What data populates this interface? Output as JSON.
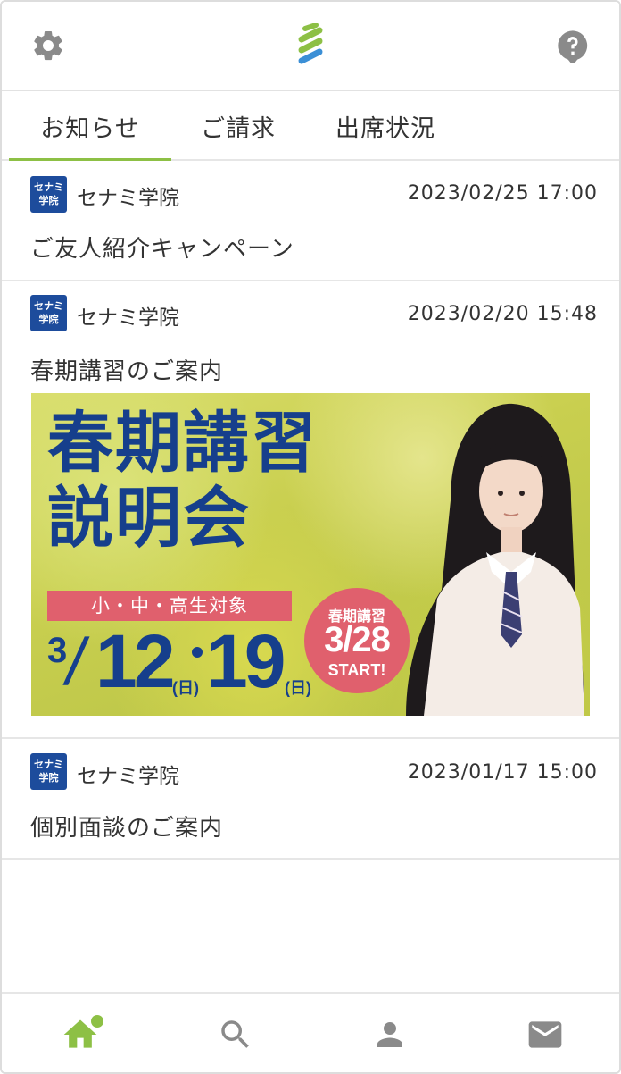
{
  "header": {
    "settings_icon": "gear-icon",
    "logo_icon": "app-logo",
    "help_icon": "help-icon"
  },
  "tabs": [
    {
      "label": "お知らせ",
      "active": true
    },
    {
      "label": "ご請求",
      "active": false
    },
    {
      "label": "出席状況",
      "active": false
    }
  ],
  "notices": [
    {
      "badge": [
        "セナミ",
        "学院"
      ],
      "school": "セナミ学院",
      "datetime": "2023/02/25 17:00",
      "title": "ご友人紹介キャンペーン"
    },
    {
      "badge": [
        "セナミ",
        "学院"
      ],
      "school": "セナミ学院",
      "datetime": "2023/02/20 15:48",
      "title": "春期講習のご案内",
      "banner": {
        "headline_line1": "春期講習",
        "headline_line2": "説明会",
        "target": "小・中・高生対象",
        "month": "3",
        "day1": "12",
        "day2": "19",
        "weekday": "(日)",
        "start_label": "春期講習",
        "start_date": "3/28",
        "start_text": "START!"
      }
    },
    {
      "badge": [
        "セナミ",
        "学院"
      ],
      "school": "セナミ学院",
      "datetime": "2023/01/17 15:00",
      "title": "個別面談のご案内"
    }
  ],
  "bottom_nav": [
    {
      "icon": "home-icon",
      "active": true,
      "badge_dot": true
    },
    {
      "icon": "search-icon",
      "active": false
    },
    {
      "icon": "account-icon",
      "active": false
    },
    {
      "icon": "mail-icon",
      "active": false
    }
  ],
  "colors": {
    "accent_green": "#8dc045",
    "badge_blue": "#1d4c9c",
    "icon_gray": "#8a8a8a",
    "banner_pink": "#e0606d",
    "banner_navy": "#163f8c"
  }
}
